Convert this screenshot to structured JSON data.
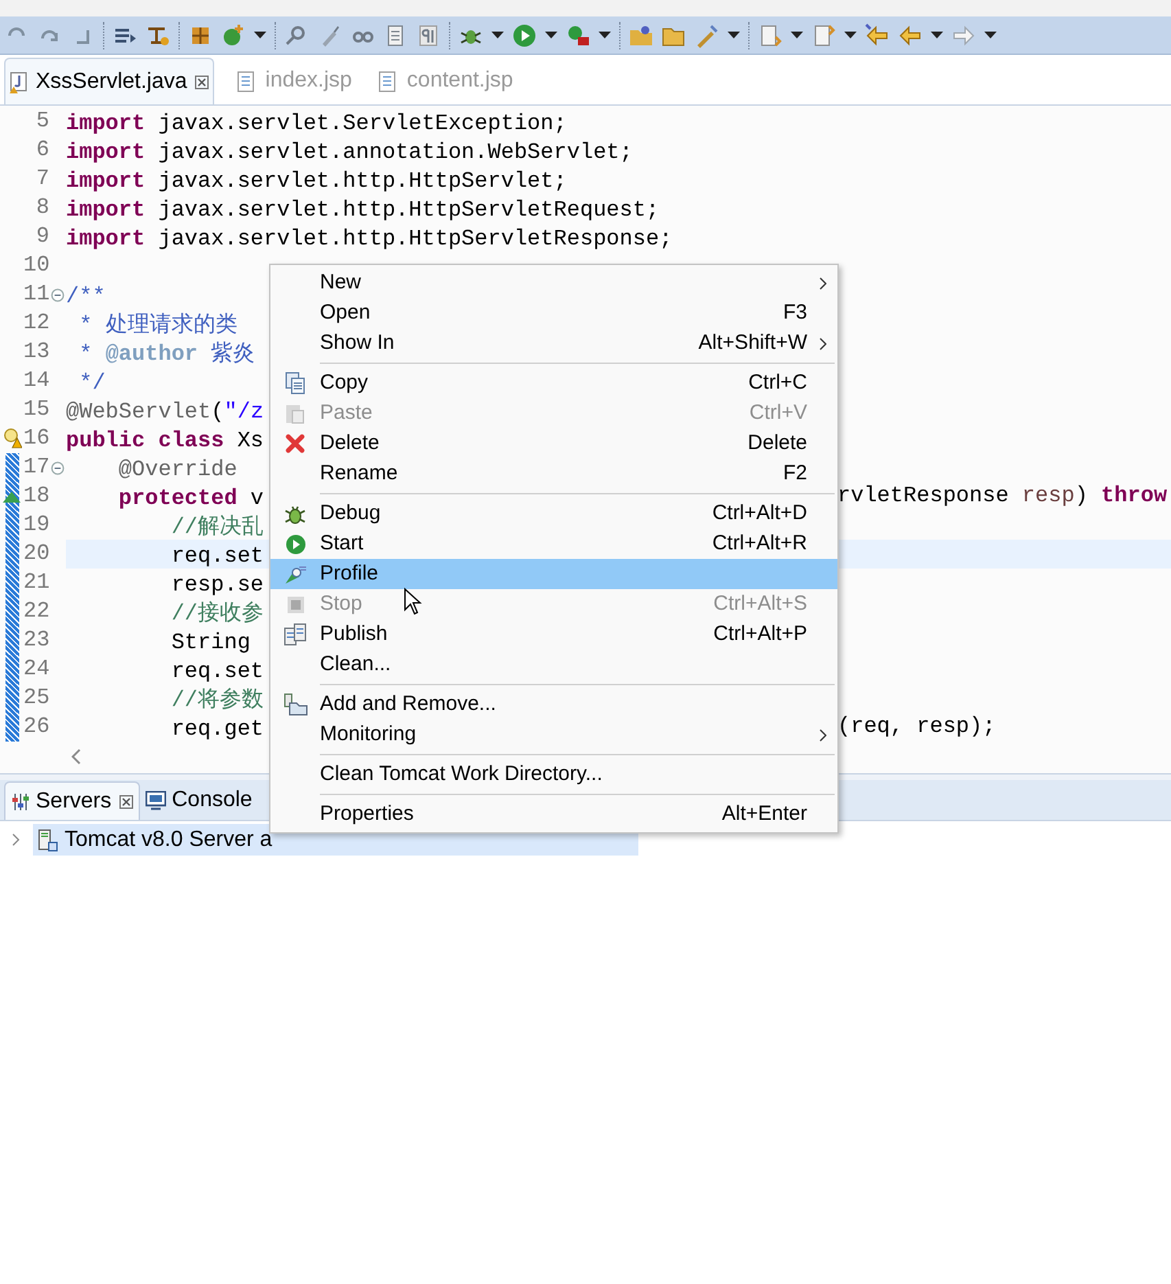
{
  "editor_tabs": [
    {
      "label": "XssServlet.java",
      "selected": true,
      "closable": true,
      "kind": "java"
    },
    {
      "label": "index.jsp",
      "selected": false,
      "closable": false,
      "kind": "jsp"
    },
    {
      "label": "content.jsp",
      "selected": false,
      "closable": false,
      "kind": "jsp"
    }
  ],
  "code_lines": [
    {
      "number": "5",
      "tokens": [
        {
          "kind": "keyword",
          "text": "import"
        },
        {
          "kind": "plain",
          "text": " javax.servlet.ServletException;"
        }
      ]
    },
    {
      "number": "6",
      "tokens": [
        {
          "kind": "keyword",
          "text": "import"
        },
        {
          "kind": "plain",
          "text": " javax.servlet.annotation.WebServlet;"
        }
      ]
    },
    {
      "number": "7",
      "tokens": [
        {
          "kind": "keyword",
          "text": "import"
        },
        {
          "kind": "plain",
          "text": " javax.servlet.http.HttpServlet;"
        }
      ]
    },
    {
      "number": "8",
      "tokens": [
        {
          "kind": "keyword",
          "text": "import"
        },
        {
          "kind": "plain",
          "text": " javax.servlet.http.HttpServletRequest;"
        }
      ]
    },
    {
      "number": "9",
      "tokens": [
        {
          "kind": "keyword",
          "text": "import"
        },
        {
          "kind": "plain",
          "text": " javax.servlet.http.HttpServletResponse;"
        }
      ]
    },
    {
      "number": "10"
    },
    {
      "number": "11",
      "folded": false,
      "tokens": [
        {
          "kind": "javadoc",
          "text": "/**"
        }
      ]
    },
    {
      "number": "12",
      "tokens": [
        {
          "kind": "javadoc",
          "text": " * 处理请求的类"
        }
      ]
    },
    {
      "number": "13",
      "tokens": [
        {
          "kind": "javadoc",
          "text": " * "
        },
        {
          "kind": "doctag",
          "text": "@author"
        },
        {
          "kind": "javadoc",
          "text": " 紫炎"
        }
      ]
    },
    {
      "number": "14",
      "tokens": [
        {
          "kind": "javadoc",
          "text": " */"
        }
      ]
    },
    {
      "number": "15",
      "tokens": [
        {
          "kind": "annotation",
          "text": "@WebServlet"
        },
        {
          "kind": "plain",
          "text": "("
        },
        {
          "kind": "string",
          "text": "\"/z"
        }
      ]
    },
    {
      "number": "16",
      "warning": true,
      "tokens": [
        {
          "kind": "keyword",
          "text": "public class"
        },
        {
          "kind": "plain",
          "text": " Xs"
        }
      ]
    },
    {
      "number": "17",
      "folded": false,
      "changed": true,
      "tokens": [
        {
          "kind": "annotation",
          "text": "    @Override"
        }
      ]
    },
    {
      "number": "18",
      "override": true,
      "changed": true,
      "tokens": [
        {
          "kind": "keyword",
          "text": "    protected"
        },
        {
          "kind": "plain",
          "text": " v"
        }
      ],
      "right": [
        {
          "kind": "plain",
          "text": "rvletResponse "
        },
        {
          "kind": "param",
          "text": "resp"
        },
        {
          "kind": "plain",
          "text": ") "
        },
        {
          "kind": "keyword",
          "text": "throw"
        }
      ]
    },
    {
      "number": "19",
      "changed": true,
      "tokens": [
        {
          "kind": "comment",
          "text": "        //解决乱"
        }
      ]
    },
    {
      "number": "20",
      "changed": true,
      "current": true,
      "tokens": [
        {
          "kind": "plain",
          "text": "        req.set"
        }
      ]
    },
    {
      "number": "21",
      "changed": true,
      "tokens": [
        {
          "kind": "plain",
          "text": "        resp.se"
        }
      ]
    },
    {
      "number": "22",
      "changed": true,
      "tokens": [
        {
          "kind": "comment",
          "text": "        //接收参"
        }
      ]
    },
    {
      "number": "23",
      "changed": true,
      "tokens": [
        {
          "kind": "plain",
          "text": "        String"
        }
      ]
    },
    {
      "number": "24",
      "changed": true,
      "tokens": [
        {
          "kind": "plain",
          "text": "        req.set"
        }
      ]
    },
    {
      "number": "25",
      "changed": true,
      "tokens": [
        {
          "kind": "comment",
          "text": "        //将参数"
        }
      ]
    },
    {
      "number": "26",
      "changed": true,
      "tokens": [
        {
          "kind": "plain",
          "text": "        req.get"
        }
      ],
      "right": [
        {
          "kind": "plain",
          "text": "(req, resp);"
        }
      ]
    }
  ],
  "panel_tabs": [
    {
      "label": "Servers",
      "selected": true,
      "closable": true,
      "kind": "servers"
    },
    {
      "label": "Console",
      "selected": false,
      "closable": false,
      "kind": "console"
    }
  ],
  "servers": [
    {
      "label": "Tomcat v8.0 Server a",
      "selected": true,
      "expanded": false
    }
  ],
  "context_menu": [
    {
      "kind": "item",
      "label": "New",
      "submenu": true,
      "disabled": false,
      "selected": false
    },
    {
      "kind": "item",
      "label": "Open",
      "shortcut": "F3",
      "disabled": false,
      "selected": false
    },
    {
      "kind": "item",
      "label": "Show In",
      "shortcut": "Alt+Shift+W",
      "submenu": true,
      "disabled": false,
      "selected": false
    },
    {
      "kind": "separator"
    },
    {
      "kind": "item",
      "label": "Copy",
      "shortcut": "Ctrl+C",
      "disabled": false,
      "selected": false
    },
    {
      "kind": "item",
      "label": "Paste",
      "shortcut": "Ctrl+V",
      "disabled": true,
      "selected": false
    },
    {
      "kind": "item",
      "label": "Delete",
      "shortcut": "Delete",
      "disabled": false,
      "selected": false
    },
    {
      "kind": "item",
      "label": "Rename",
      "shortcut": "F2",
      "disabled": false,
      "selected": false
    },
    {
      "kind": "separator"
    },
    {
      "kind": "item",
      "label": "Debug",
      "shortcut": "Ctrl+Alt+D",
      "disabled": false,
      "selected": false
    },
    {
      "kind": "item",
      "label": "Start",
      "shortcut": "Ctrl+Alt+R",
      "disabled": false,
      "selected": false
    },
    {
      "kind": "item",
      "label": "Profile",
      "disabled": false,
      "selected": true
    },
    {
      "kind": "item",
      "label": "Stop",
      "shortcut": "Ctrl+Alt+S",
      "disabled": true,
      "selected": false
    },
    {
      "kind": "item",
      "label": "Publish",
      "shortcut": "Ctrl+Alt+P",
      "disabled": false,
      "selected": false
    },
    {
      "kind": "item",
      "label": "Clean...",
      "disabled": false,
      "selected": false
    },
    {
      "kind": "separator"
    },
    {
      "kind": "item",
      "label": "Add and Remove...",
      "disabled": false,
      "selected": false
    },
    {
      "kind": "item",
      "label": "Monitoring",
      "submenu": true,
      "disabled": false,
      "selected": false
    },
    {
      "kind": "separator"
    },
    {
      "kind": "item",
      "label": "Clean Tomcat Work Directory...",
      "disabled": false,
      "selected": false
    },
    {
      "kind": "separator"
    },
    {
      "kind": "item",
      "label": "Properties",
      "shortcut": "Alt+Enter",
      "disabled": false,
      "selected": false
    }
  ]
}
